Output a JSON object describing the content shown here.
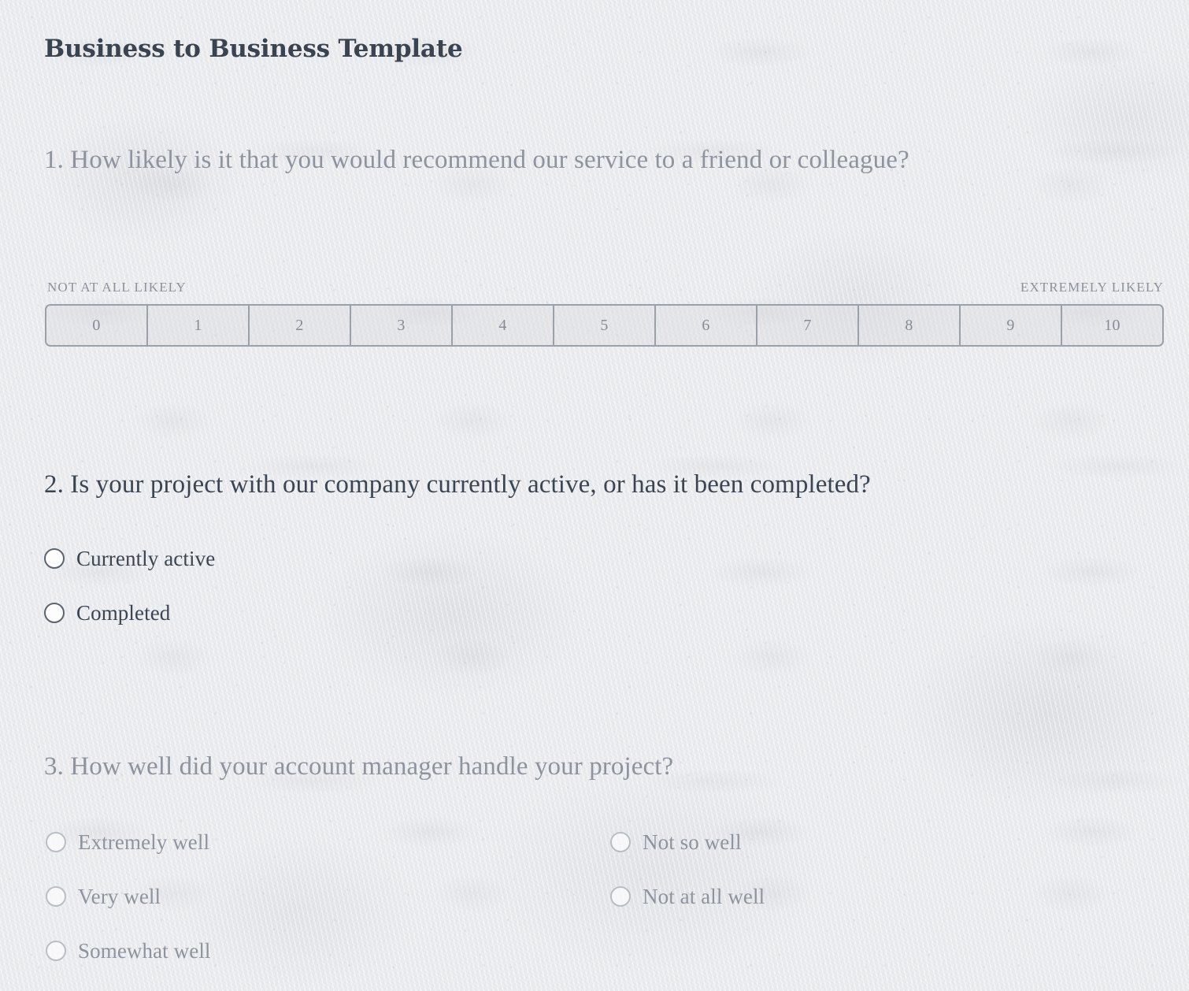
{
  "page": {
    "title": "Business to Business Template",
    "background_color": "#ebecef",
    "title_color": "#3a4450",
    "dim_text_color": "#8e949d",
    "focus_text_color": "#3b4551"
  },
  "questions": [
    {
      "number": "1.",
      "text": "1. How likely is it that you would recommend our service to a friend or colleague?",
      "type": "nps-scale",
      "state": "inactive",
      "scale": {
        "left_label": "NOT AT ALL LIKELY",
        "right_label": "EXTREMELY LIKELY",
        "values": [
          "0",
          "1",
          "2",
          "3",
          "4",
          "5",
          "6",
          "7",
          "8",
          "9",
          "10"
        ],
        "selected": null,
        "border_color": "#9ba1a9"
      }
    },
    {
      "number": "2.",
      "text": "2. Is your project with our company currently active, or has it been completed?",
      "type": "radio",
      "state": "active",
      "columns": 1,
      "options": [
        {
          "label": "Currently active",
          "selected": false
        },
        {
          "label": "Completed",
          "selected": false
        }
      ]
    },
    {
      "number": "3.",
      "text": "3. How well did your account manager handle your project?",
      "type": "radio",
      "state": "inactive",
      "columns": 2,
      "options": [
        {
          "label": "Extremely well",
          "selected": false
        },
        {
          "label": "Very well",
          "selected": false
        },
        {
          "label": "Somewhat well",
          "selected": false
        },
        {
          "label": "Not so well",
          "selected": false
        },
        {
          "label": "Not at all well",
          "selected": false
        }
      ]
    }
  ]
}
